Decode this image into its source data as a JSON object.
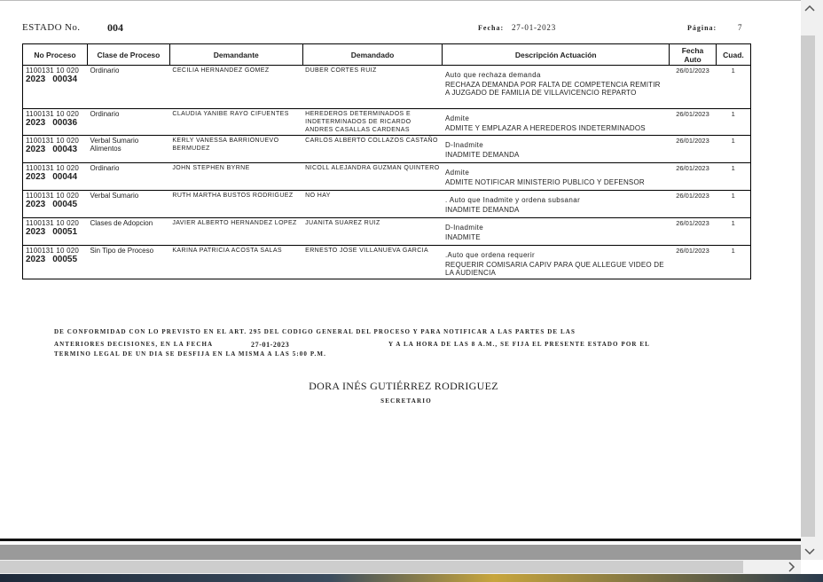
{
  "header": {
    "estado_label": "ESTADO No.",
    "estado_num": "004",
    "fecha_label": "Fecha:",
    "fecha_value": "27-01-2023",
    "pagina_label": "Página:",
    "pagina_value": "7"
  },
  "table": {
    "headers": {
      "proceso": "No Proceso",
      "clase": "Clase de Proceso",
      "demandante": "Demandante",
      "demandado": "Demandado",
      "descripcion": "Descripción Actuación",
      "fecha_line1": "Fecha",
      "fecha_line2": "Auto",
      "cuad": "Cuad."
    },
    "rows": [
      {
        "code": "1100131 10 020",
        "year": "2023",
        "num": "00034",
        "clase": "Ordinario",
        "demandante": "CECILIA HERNANDEZ GOMEZ",
        "demandado": "DUBER CORTES RUIZ",
        "act1": "Auto que rechaza demanda",
        "act2": "RECHAZA DEMANDA POR FALTA DE COMPETENCIA REMITIR A JUZGADO DE FAMILIA DE VILLAVICENCIO REPARTO",
        "fecha": "26/01/2023",
        "cuad": "1"
      },
      {
        "code": "1100131 10 020",
        "year": "2023",
        "num": "00036",
        "clase": "Ordinario",
        "demandante": "CLAUDIA YANIBE RAYO CIFUENTES",
        "demandado": "HEREDEROS DETERMINADOS E INDETERMINADOS DE RICARDO ANDRES CASALLAS CARDENAS",
        "act1": "Admite",
        "act2": "ADMITE Y EMPLAZAR A HEREDEROS INDETERMINADOS",
        "fecha": "26/01/2023",
        "cuad": "1"
      },
      {
        "code": "1100131 10 020",
        "year": "2023",
        "num": "00043",
        "clase": "Verbal Sumario Alimentos",
        "demandante": "KERLY VANESSA BARRIONUEVO BERMUDEZ",
        "demandado": "CARLOS ALBERTO COLLAZOS CASTAÑO",
        "act1": "D-Inadmite",
        "act2": "INADMITE DEMANDA",
        "fecha": "26/01/2023",
        "cuad": "1"
      },
      {
        "code": "1100131 10 020",
        "year": "2023",
        "num": "00044",
        "clase": "Ordinario",
        "demandante": "JOHN STEPHEN BYRNE",
        "demandado": "NICOLL ALEJANDRA GUZMAN QUINTERO",
        "act1": "Admite",
        "act2": "ADMITE NOTIFICAR MINISTERIO PUBLICO Y DEFENSOR",
        "fecha": "26/01/2023",
        "cuad": "1"
      },
      {
        "code": "1100131 10 020",
        "year": "2023",
        "num": "00045",
        "clase": "Verbal Sumario",
        "demandante": "RUTH MARTHA BUSTOS RODRIGUEZ",
        "demandado": "NO HAY",
        "act1": ". Auto que Inadmite y ordena subsanar",
        "act2": "INADMITE DEMANDA",
        "fecha": "26/01/2023",
        "cuad": "1"
      },
      {
        "code": "1100131 10 020",
        "year": "2023",
        "num": "00051",
        "clase": "Clases de Adopcion",
        "demandante": "JAVIER ALBERTO HERNANDEZ LOPEZ",
        "demandado": "JUANITA SUAREZ RUIZ",
        "act1": "D-Inadmite",
        "act2": "INADMITE",
        "fecha": "26/01/2023",
        "cuad": "1"
      },
      {
        "code": "1100131 10 020",
        "year": "2023",
        "num": "00055",
        "clase": "Sin Tipo de Proceso",
        "demandante": "KARINA PATRICIA ACOSTA SALAS",
        "demandado": "ERNESTO JOSE VILLANUEVA GARCIA",
        "act1": ".Auto que ordena requerir",
        "act2": "REQUERIR COMISARIA CAPIV PARA QUE ALLEGUE VIDEO DE LA AUDIENCIA",
        "fecha": "26/01/2023",
        "cuad": "1"
      }
    ]
  },
  "footer": {
    "line1": "DE CONFORMIDAD CON LO PREVISTO EN EL ART. 295 DEL CODIGO GENERAL DEL PROCESO Y PARA NOTIFICAR A LAS PARTES DE LAS",
    "line2a": "ANTERIORES DECISIONES, EN LA FECHA",
    "line2_date": "27-01-2023",
    "line2b": "Y A LA HORA DE LAS 8 A.M., SE FIJA EL PRESENTE ESTADO POR EL",
    "line3": "TERMINO LEGAL DE UN DIA SE DESFIJA EN LA MISMA A LAS 5:00 P.M.",
    "signer_name": "DORA INÉS GUTIÉRREZ RODRIGUEZ",
    "signer_role": "SECRETARIO"
  },
  "scrollbars": {
    "up_icon": "chevron-up",
    "down_icon": "chevron-down",
    "right_icon": "chevron-right"
  }
}
